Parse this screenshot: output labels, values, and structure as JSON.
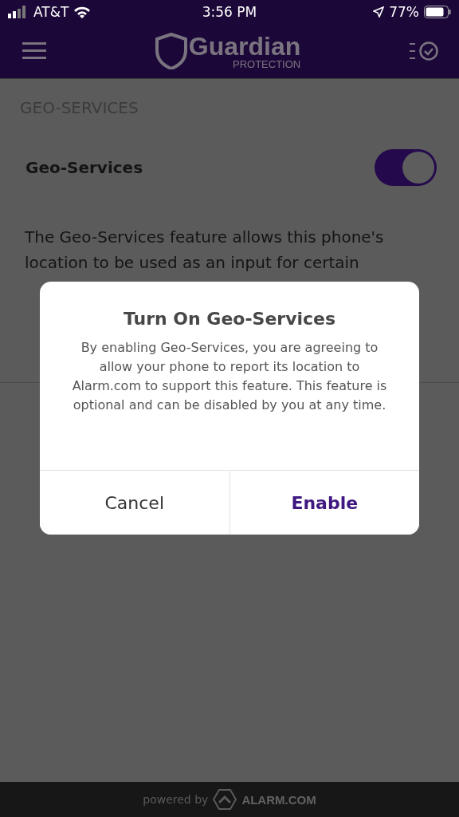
{
  "status_bar": {
    "carrier": "AT&T",
    "time": "3:56 PM",
    "battery": "77%"
  },
  "header": {
    "logo_name": "Guardian",
    "logo_tagline": "PROTECTION"
  },
  "section": {
    "title": "GEO-SERVICES"
  },
  "setting": {
    "label": "Geo-Services",
    "on": true
  },
  "description_lines": [
    "The Geo-Services feature allows this phone's",
    "location to be used as an input for certain"
  ],
  "dialog": {
    "title": "Turn On Geo-Services",
    "message": "By enabling Geo-Services, you are agreeing to allow your phone to report its location to Alarm.com to support this feature. This feature is optional and can be disabled by you at any time.",
    "buttons": [
      {
        "label": "Cancel",
        "kind": "cancel"
      },
      {
        "label": "Enable",
        "kind": "primary"
      }
    ]
  },
  "footer": {
    "powered_by": "powered by",
    "brand": "ALARM.COM"
  }
}
